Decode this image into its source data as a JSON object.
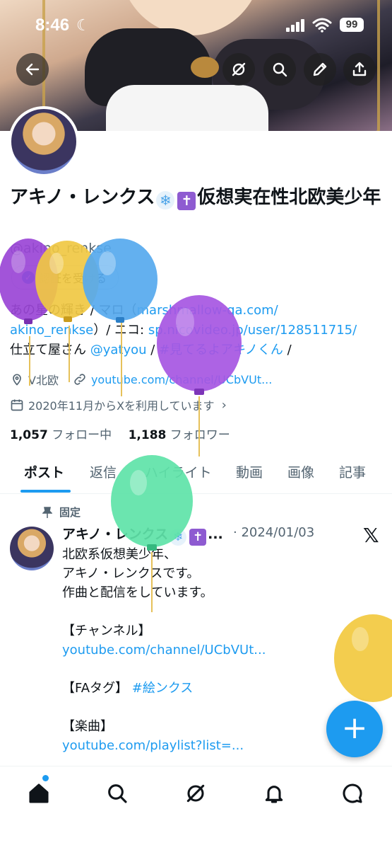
{
  "status_bar": {
    "time": "8:46",
    "battery": "99"
  },
  "profile": {
    "display_name": "アキノ・レンクス❄️✝️仮想実在性北欧美少年",
    "name_text": "アキノ・レンクス",
    "name_suffix": "仮想実在性北欧美少年",
    "handle": "@akino_renkse",
    "verify_label": "認証を受ける",
    "bio_line1_pre": "あの星の輝き / マロ（",
    "bio_link1a": "marshmallow-qa.com/",
    "bio_link1b": "akino_renkse",
    "bio_line2_mid": "）/ ニコ: ",
    "bio_link2": "sp.nicovideo.jp/user/128511715/",
    "bio_line3_pre": "仕立て屋さん ",
    "bio_mention": "@yatyou",
    "bio_sep": " / ",
    "bio_hashtag": "#見てるよアキノくん",
    "bio_end": " /",
    "location": "V北欧",
    "website": "youtube.com/channel/UCbVUt...",
    "joined": "2020年11月からXを利用しています",
    "following_count": "1,057",
    "following_label": "フォロー中",
    "followers_count": "1,188",
    "followers_label": "フォロワー"
  },
  "tabs": [
    "ポスト",
    "返信",
    "ハイライト",
    "動画",
    "画像",
    "記事"
  ],
  "pinned_post": {
    "pinned_label": "固定",
    "author": "アキノ・レンクス",
    "author_ellipsis": "...",
    "date": "· 2024/01/03",
    "line1": "北欧系仮想美少年、",
    "line2": "アキノ・レンクスです。",
    "line3": "作曲と配信をしています。",
    "channel_label": "【チャンネル】",
    "channel_link": "youtube.com/channel/UCbVUt...",
    "fa_label": "【FAタグ】 ",
    "fa_tag": "#絵ンクス",
    "music_label": "【楽曲】",
    "music_link": "youtube.com/playlist?list=..."
  },
  "fab_label": "+",
  "icons": {
    "back": "back-arrow-icon",
    "grok": "grok-icon",
    "search": "search-icon",
    "edit": "edit-icon",
    "share": "share-icon",
    "home": "home-icon",
    "notifications": "bell-icon",
    "messages": "message-icon"
  },
  "colors": {
    "accent": "#1d9bf0",
    "text": "#0f1419",
    "muted": "#536471"
  }
}
